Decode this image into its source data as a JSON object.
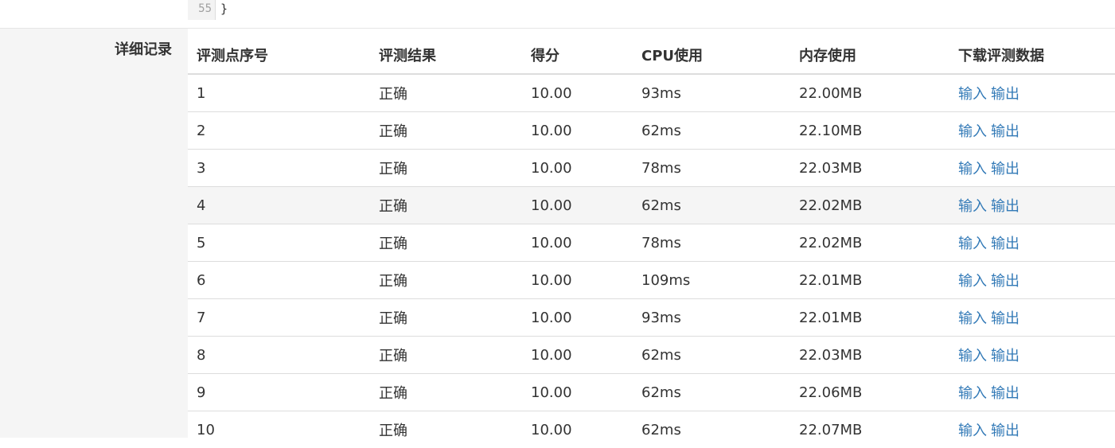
{
  "code": {
    "line_number": "55",
    "line_text": "}"
  },
  "section": {
    "label": "详细记录"
  },
  "table": {
    "headers": [
      "评测点序号",
      "评测结果",
      "得分",
      "CPU使用",
      "内存使用",
      "下载评测数据"
    ],
    "rows": [
      {
        "id": "1",
        "result": "正确",
        "score": "10.00",
        "cpu": "93ms",
        "mem": "22.00MB",
        "in": "输入",
        "out": "输出"
      },
      {
        "id": "2",
        "result": "正确",
        "score": "10.00",
        "cpu": "62ms",
        "mem": "22.10MB",
        "in": "输入",
        "out": "输出"
      },
      {
        "id": "3",
        "result": "正确",
        "score": "10.00",
        "cpu": "78ms",
        "mem": "22.03MB",
        "in": "输入",
        "out": "输出"
      },
      {
        "id": "4",
        "result": "正确",
        "score": "10.00",
        "cpu": "62ms",
        "mem": "22.02MB",
        "in": "输入",
        "out": "输出"
      },
      {
        "id": "5",
        "result": "正确",
        "score": "10.00",
        "cpu": "78ms",
        "mem": "22.02MB",
        "in": "输入",
        "out": "输出"
      },
      {
        "id": "6",
        "result": "正确",
        "score": "10.00",
        "cpu": "109ms",
        "mem": "22.01MB",
        "in": "输入",
        "out": "输出"
      },
      {
        "id": "7",
        "result": "正确",
        "score": "10.00",
        "cpu": "93ms",
        "mem": "22.01MB",
        "in": "输入",
        "out": "输出"
      },
      {
        "id": "8",
        "result": "正确",
        "score": "10.00",
        "cpu": "62ms",
        "mem": "22.03MB",
        "in": "输入",
        "out": "输出"
      },
      {
        "id": "9",
        "result": "正确",
        "score": "10.00",
        "cpu": "62ms",
        "mem": "22.06MB",
        "in": "输入",
        "out": "输出"
      },
      {
        "id": "10",
        "result": "正确",
        "score": "10.00",
        "cpu": "62ms",
        "mem": "22.07MB",
        "in": "输入",
        "out": "输出"
      }
    ]
  },
  "colors": {
    "link": "#337ab7",
    "text": "#333333",
    "row_hover": "#f5f5f5",
    "border": "#dddddd"
  }
}
